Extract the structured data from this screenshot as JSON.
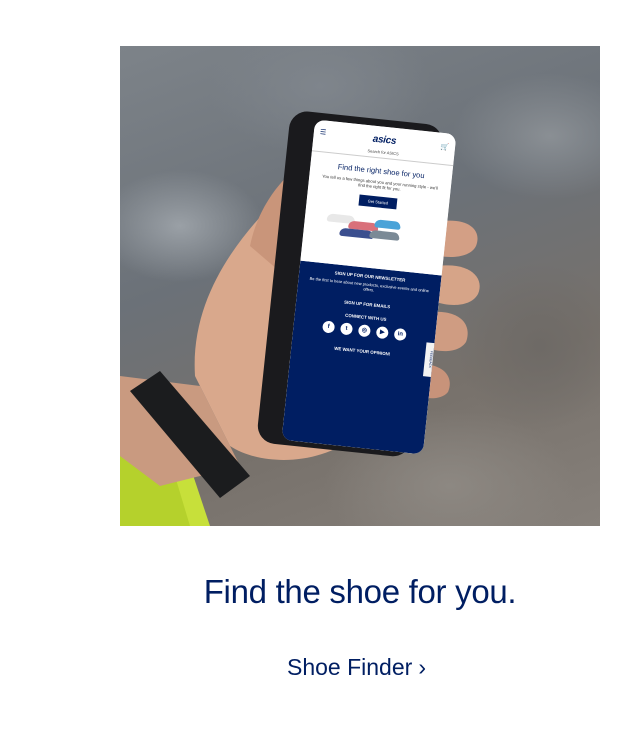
{
  "hero": {
    "image_alt": "Hand holding a phone showing the ASICS Shoe Finder page",
    "phone": {
      "logo": "asics",
      "search": "Search for ASICS",
      "heading": "Find the right shoe for you",
      "copy": "You tell us a few things about you and your running style - we'll find the right fit for you.",
      "button": "Get Started",
      "newsletter_title": "SIGN UP FOR OUR NEWSLETTER",
      "newsletter_copy": "Be the first to hear about new products, exclusive events and online offers.",
      "signup_link": "SIGN UP FOR EMAILS",
      "connect": "CONNECT WITH US",
      "opinion": "WE WANT YOUR OPINION!",
      "feedback": "FEEDBACK",
      "social_icons": [
        "facebook-icon",
        "twitter-icon",
        "instagram-icon",
        "youtube-icon",
        "linkedin-icon"
      ]
    }
  },
  "headline": "Find the shoe for you.",
  "cta": {
    "label": "Shoe Finder",
    "chevron": "›"
  },
  "colors": {
    "brand_navy": "#001e62",
    "background": "#ffffff"
  }
}
